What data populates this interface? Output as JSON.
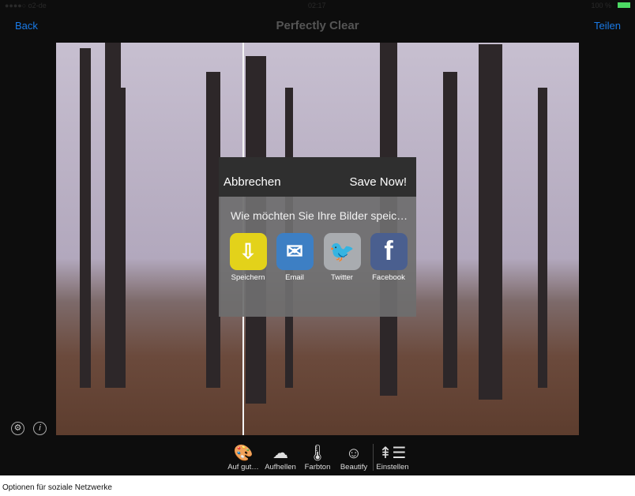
{
  "status": {
    "carrier": "●●●●○ o2-de",
    "time": "02:17",
    "battery": "100 %"
  },
  "nav": {
    "back": "Back",
    "title": "Perfectly Clear",
    "share": "Teilen"
  },
  "dialog": {
    "cancel": "Abbrechen",
    "save": "Save Now!",
    "question": "Wie möchten Sie Ihre Bilder speic…",
    "options": [
      {
        "label": "Speichern",
        "icon": "folder-download-icon",
        "color": "#e3d21a"
      },
      {
        "label": "Email",
        "icon": "mail-icon",
        "color": "#3d7fc4"
      },
      {
        "label": "Twitter",
        "icon": "twitter-icon",
        "color": "#a9acb0"
      },
      {
        "label": "Facebook",
        "icon": "facebook-icon",
        "color": "#4a5f8f"
      }
    ]
  },
  "toolbar": {
    "items": [
      {
        "label": "Auf gut…"
      },
      {
        "label": "Aufhellen"
      },
      {
        "label": "Farbton"
      },
      {
        "label": "Beautify"
      },
      {
        "label": "Einstellen"
      }
    ]
  },
  "caption": "Optionen für soziale Netzwerke"
}
